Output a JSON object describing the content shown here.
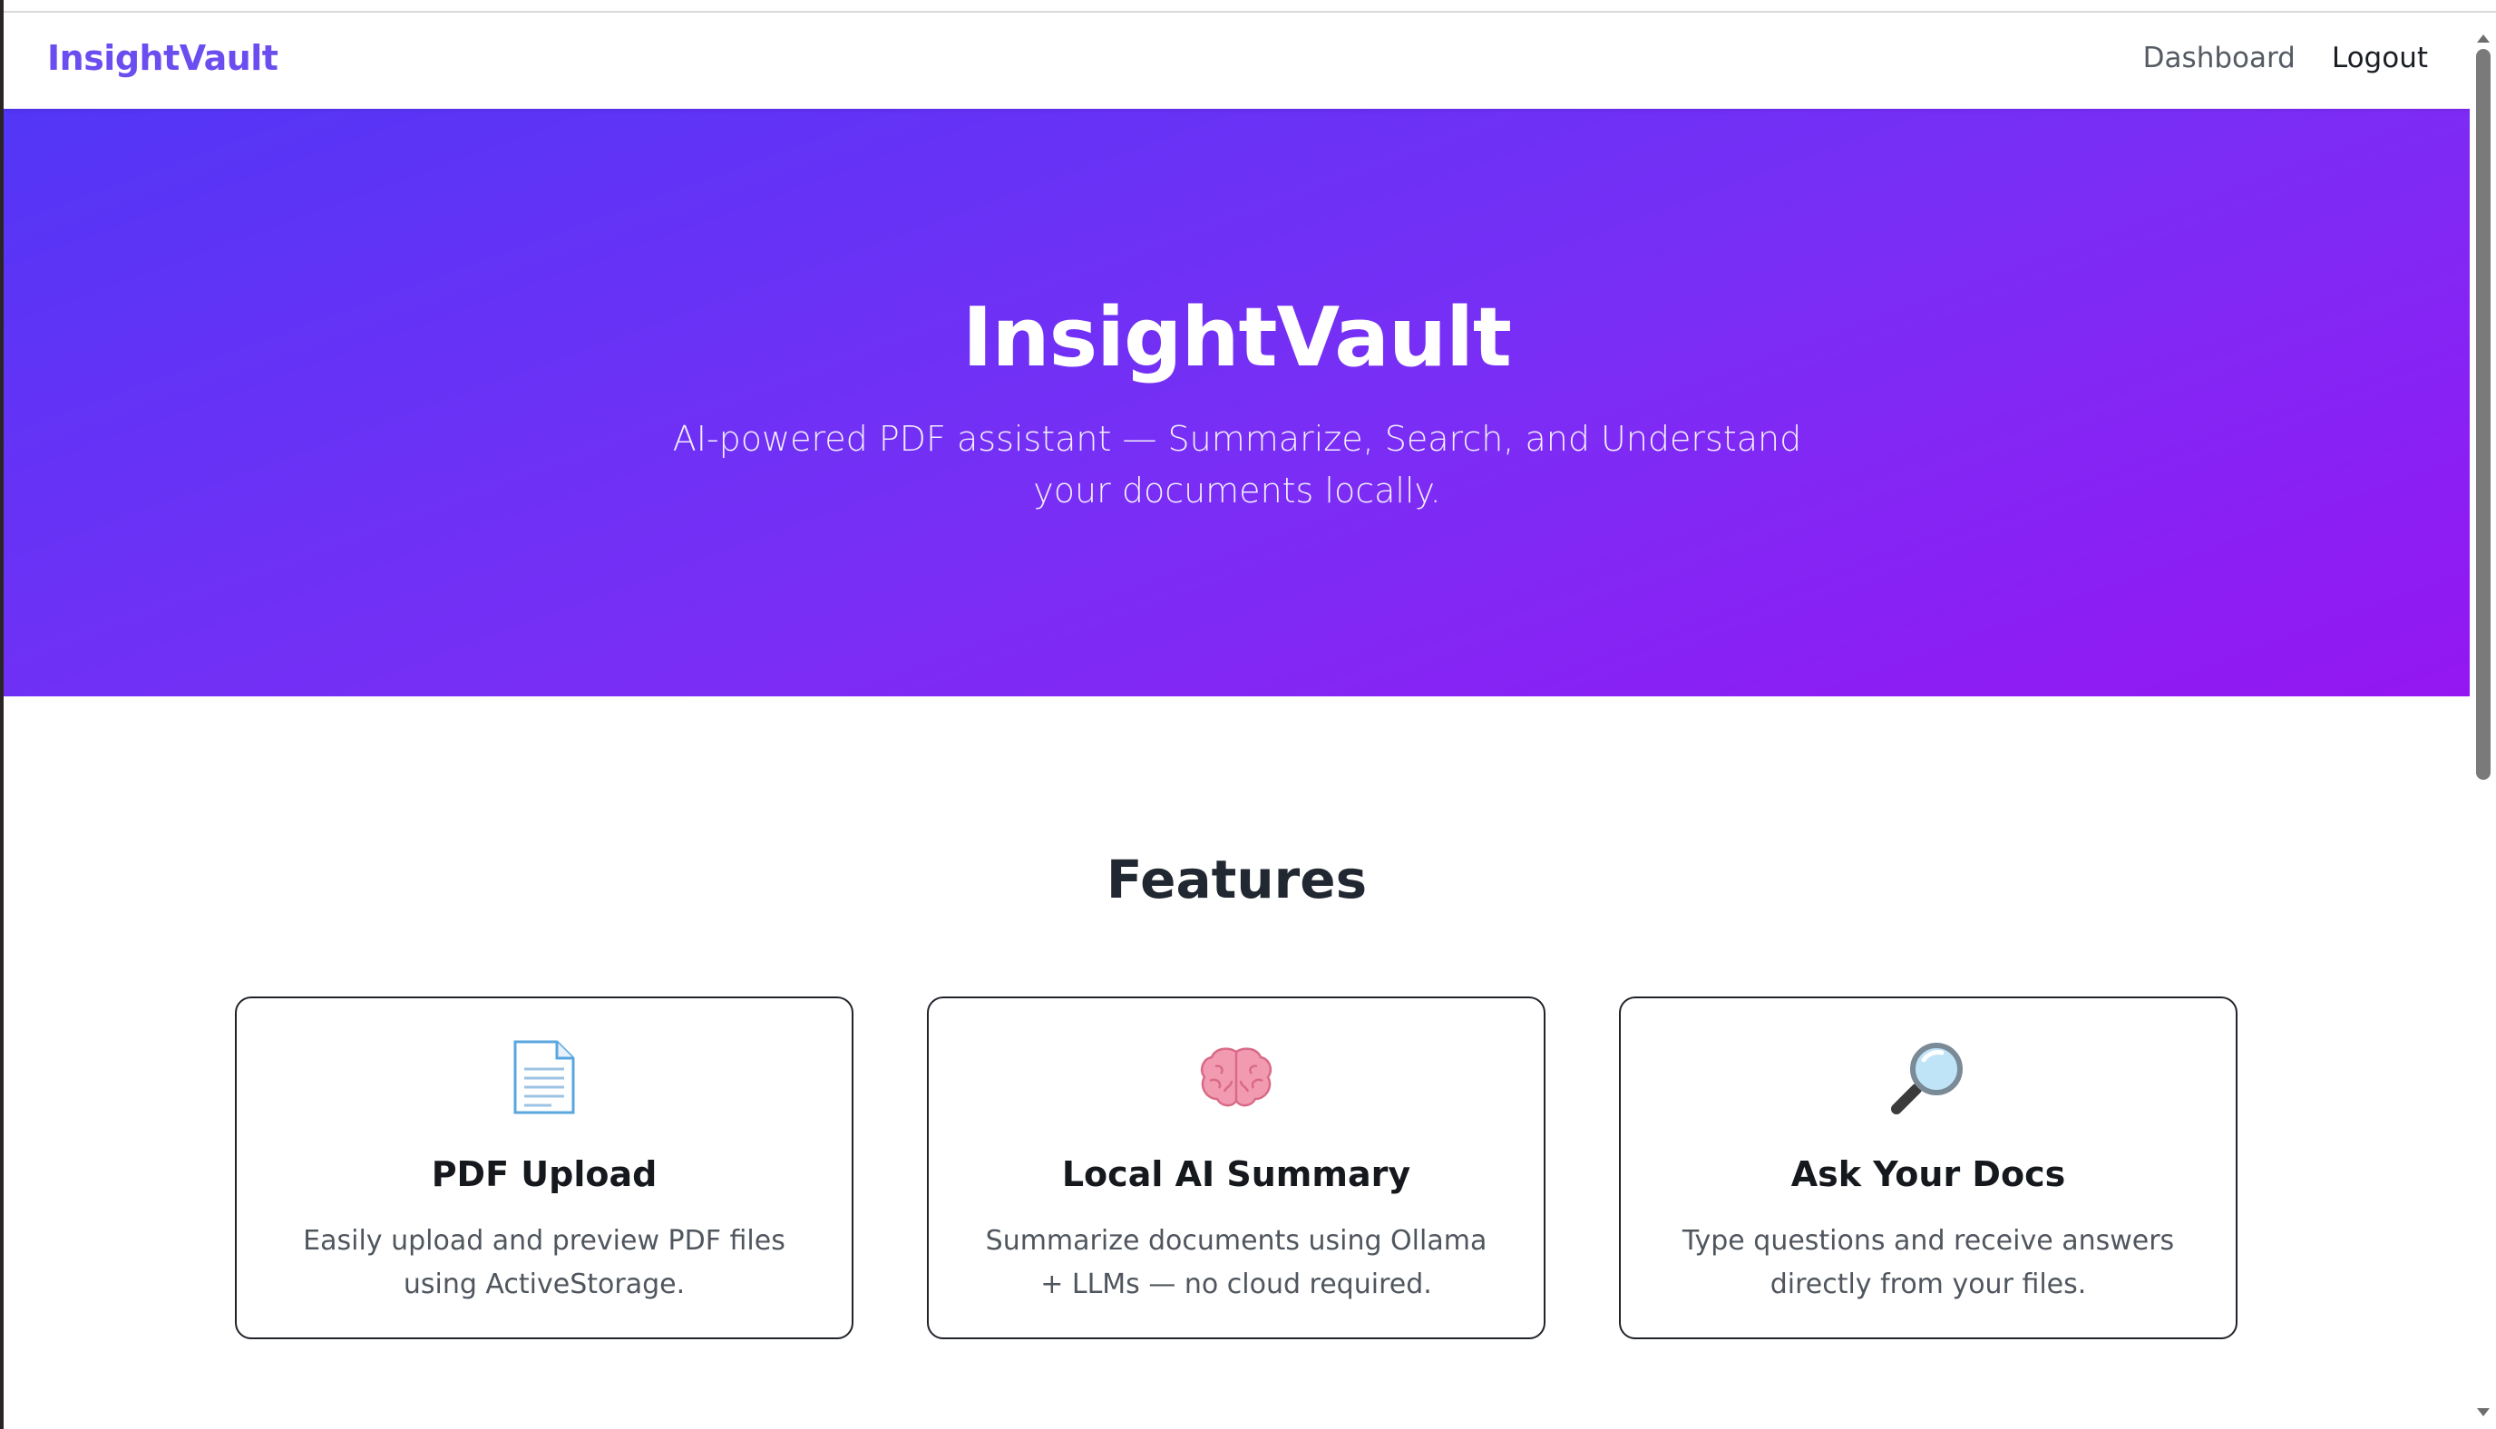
{
  "navbar": {
    "brand": "InsightVault",
    "links": [
      {
        "label": "Dashboard"
      },
      {
        "label": "Logout"
      }
    ]
  },
  "hero": {
    "title": "InsightVault",
    "subtitle": "AI-powered PDF assistant — Summarize, Search, and Understand your documents locally."
  },
  "features": {
    "title": "Features",
    "cards": [
      {
        "icon": "document-icon",
        "title": "PDF Upload",
        "description": "Easily upload and preview PDF files using ActiveStorage."
      },
      {
        "icon": "brain-icon",
        "title": "Local AI Summary",
        "description": "Summarize documents using Ollama + LLMs — no cloud required."
      },
      {
        "icon": "magnifier-icon",
        "title": "Ask Your Docs",
        "description": "Type questions and receive answers directly from your files."
      }
    ]
  },
  "colors": {
    "brand": "#6b4df0",
    "hero_gradient_start": "#5336f6",
    "hero_gradient_end": "#9417f2"
  }
}
